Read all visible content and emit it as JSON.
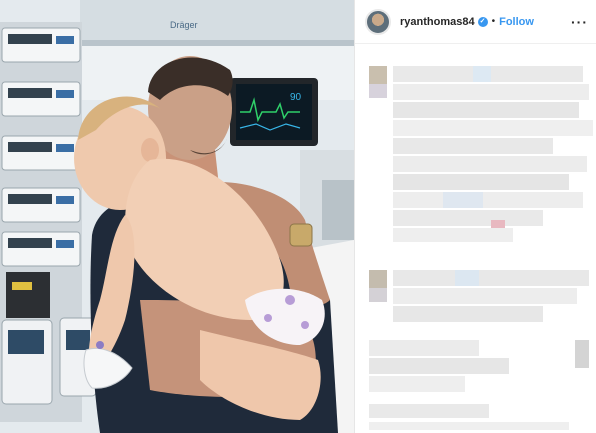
{
  "post": {
    "username": "ryanthomas84",
    "separator": "•",
    "follow_label": "Follow",
    "more_label": "···",
    "verified_glyph": "✓",
    "equipment_brand": "Dräger",
    "monitor_readout": "90"
  },
  "icons": {
    "verified": "verified-badge-icon",
    "more": "more-options-icon"
  },
  "colors": {
    "accent": "#3897f0",
    "text": "#262626",
    "pixelated_gray": "#e9e9e9"
  }
}
